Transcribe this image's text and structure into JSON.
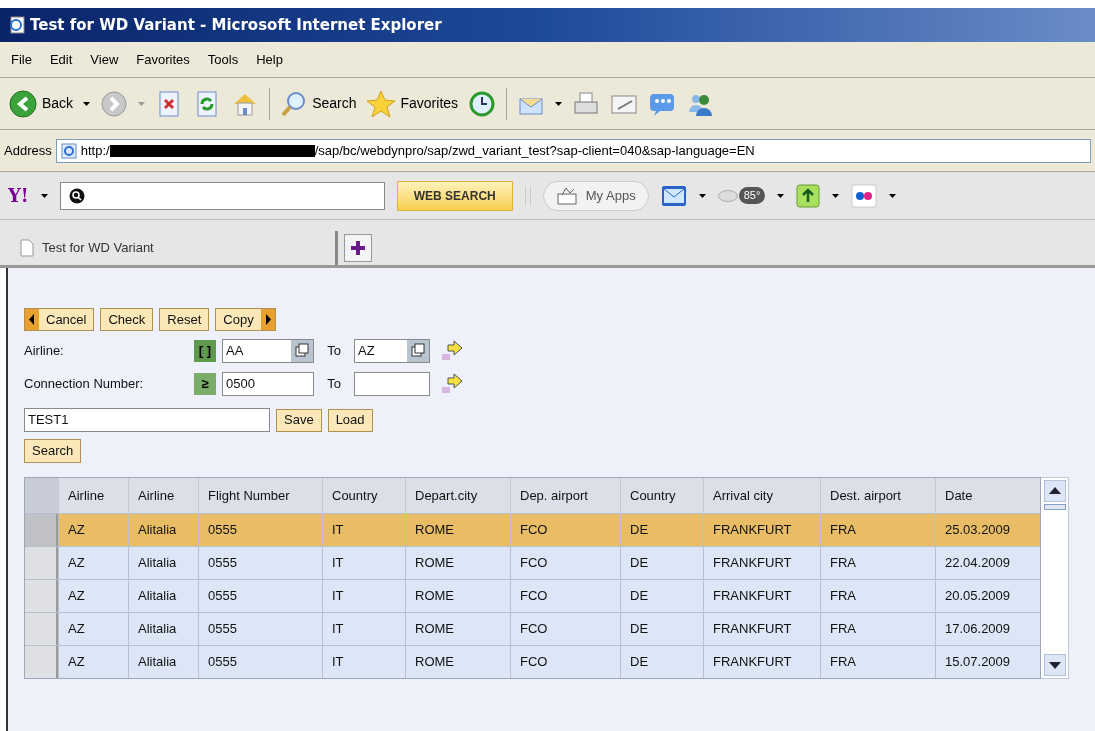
{
  "window": {
    "title": "Test for WD Variant - Microsoft Internet Explorer"
  },
  "menu": [
    "File",
    "Edit",
    "View",
    "Favorites",
    "Tools",
    "Help"
  ],
  "toolbar": {
    "back": "Back",
    "search": "Search",
    "favorites": "Favorites"
  },
  "address": {
    "label": "Address",
    "url_start": "http:/",
    "url_end": "/sap/bc/webdynpro/sap/zwd_variant_test?sap-client=040&sap-language=EN"
  },
  "yahoo_bar": {
    "logo": "Y!",
    "search_button": "WEB SEARCH",
    "my_apps": "My Apps",
    "weather": "85°"
  },
  "tabs": [
    {
      "label": "Test for WD Variant",
      "selected": true
    }
  ],
  "actions": [
    {
      "label": "Cancel",
      "kind": "prev"
    },
    {
      "label": "Check",
      "kind": "plain"
    },
    {
      "label": "Reset",
      "kind": "plain"
    },
    {
      "label": "Copy",
      "kind": "next"
    }
  ],
  "criteria": [
    {
      "label": "Airline:",
      "operator": "[ ]",
      "kind": "between",
      "low": "AA",
      "to": "To",
      "high": "AZ",
      "value_help": true
    },
    {
      "label": "Connection Number:",
      "operator": "≥",
      "kind": "ge",
      "low": "0500",
      "to": "To",
      "value_help": false
    }
  ],
  "variant": {
    "value": "TEST1",
    "save": "Save",
    "load": "Load"
  },
  "search_button": "Search",
  "table": {
    "columns": [
      "Airline",
      "Airline",
      "Flight Number",
      "Country",
      "Depart.city",
      "Dep. airport",
      "Country",
      "Arrival city",
      "Dest. airport",
      "Date"
    ],
    "rows": [
      {
        "selected": true,
        "cells": [
          "AZ",
          "Alitalia",
          "0555",
          "IT",
          "ROME",
          "FCO",
          "DE",
          "FRANKFURT",
          "FRA",
          "25.03.2009"
        ]
      },
      {
        "selected": false,
        "cells": [
          "AZ",
          "Alitalia",
          "0555",
          "IT",
          "ROME",
          "FCO",
          "DE",
          "FRANKFURT",
          "FRA",
          "22.04.2009"
        ]
      },
      {
        "selected": false,
        "cells": [
          "AZ",
          "Alitalia",
          "0555",
          "IT",
          "ROME",
          "FCO",
          "DE",
          "FRANKFURT",
          "FRA",
          "20.05.2009"
        ]
      },
      {
        "selected": false,
        "cells": [
          "AZ",
          "Alitalia",
          "0555",
          "IT",
          "ROME",
          "FCO",
          "DE",
          "FRANKFURT",
          "FRA",
          "17.06.2009"
        ]
      },
      {
        "selected": false,
        "cells": [
          "AZ",
          "Alitalia",
          "0555",
          "IT",
          "ROME",
          "FCO",
          "DE",
          "FRANKFURT",
          "FRA",
          "15.07.2009"
        ]
      }
    ]
  }
}
